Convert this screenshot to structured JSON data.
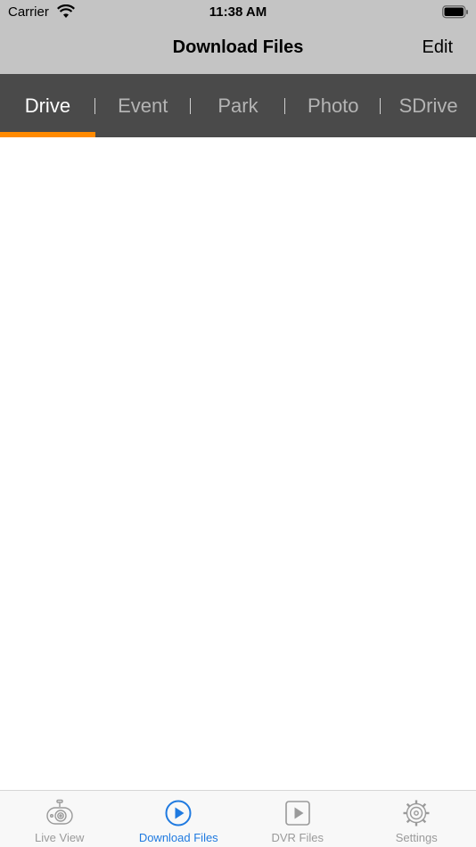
{
  "status_bar": {
    "carrier": "Carrier",
    "time": "11:38 AM",
    "icons": [
      "wifi-icon",
      "battery-icon"
    ]
  },
  "nav": {
    "title": "Download Files",
    "edit_label": "Edit"
  },
  "tabs": [
    {
      "label": "Drive",
      "active": true
    },
    {
      "label": "Event",
      "active": false
    },
    {
      "label": "Park",
      "active": false
    },
    {
      "label": "Photo",
      "active": false
    },
    {
      "label": "SDrive",
      "active": false
    }
  ],
  "tabbar": {
    "items": [
      {
        "label": "Live View",
        "icon": "dashcam-icon",
        "active": false
      },
      {
        "label": "Download Files",
        "icon": "play-circle-icon",
        "active": true
      },
      {
        "label": "DVR Files",
        "icon": "play-square-icon",
        "active": false
      },
      {
        "label": "Settings",
        "icon": "gear-icon",
        "active": false
      }
    ]
  },
  "colors": {
    "header_bg": "#c4c4c4",
    "tabs_bg": "#4a4a4a",
    "tab_indicator": "#ff8a00",
    "tabbar_active": "#1f7ae0",
    "tabbar_inactive": "#9a9a9a"
  }
}
